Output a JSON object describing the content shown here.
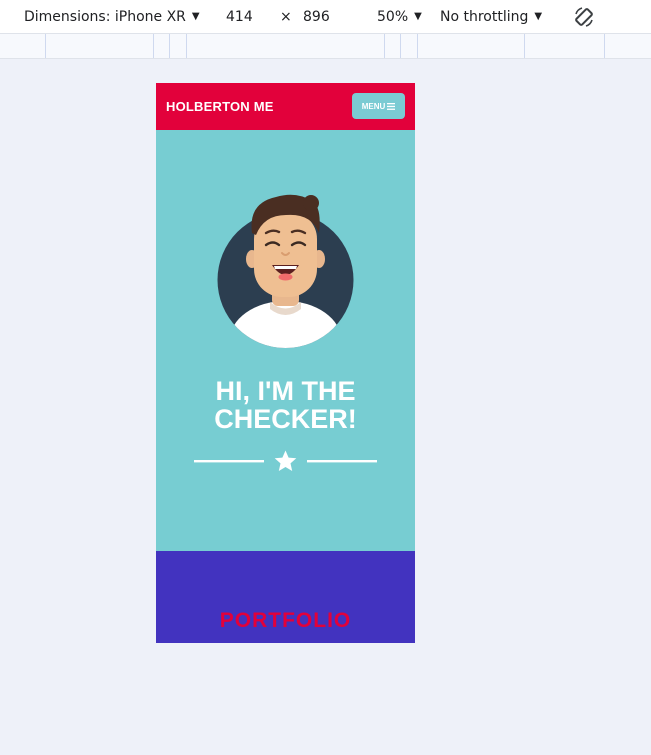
{
  "devtools": {
    "dimensions_label": "Dimensions: iPhone XR",
    "width": "414",
    "times": "×",
    "height": "896",
    "zoom": "50%",
    "throttling": "No throttling"
  },
  "site": {
    "brand": "HOLBERTON ME",
    "menu_label": "MENU",
    "hero_title_line1": "HI, I'M THE",
    "hero_title_line2": "CHECKER!",
    "portfolio_title": "PORTFOLIO"
  },
  "colors": {
    "header": "#e2013b",
    "hero": "#77cdd2",
    "portfolio": "#4233bf",
    "avatar_bg": "#2c3e50"
  },
  "icons": {
    "rotate": "rotate-icon",
    "menu": "hamburger-icon",
    "star": "star-icon"
  }
}
